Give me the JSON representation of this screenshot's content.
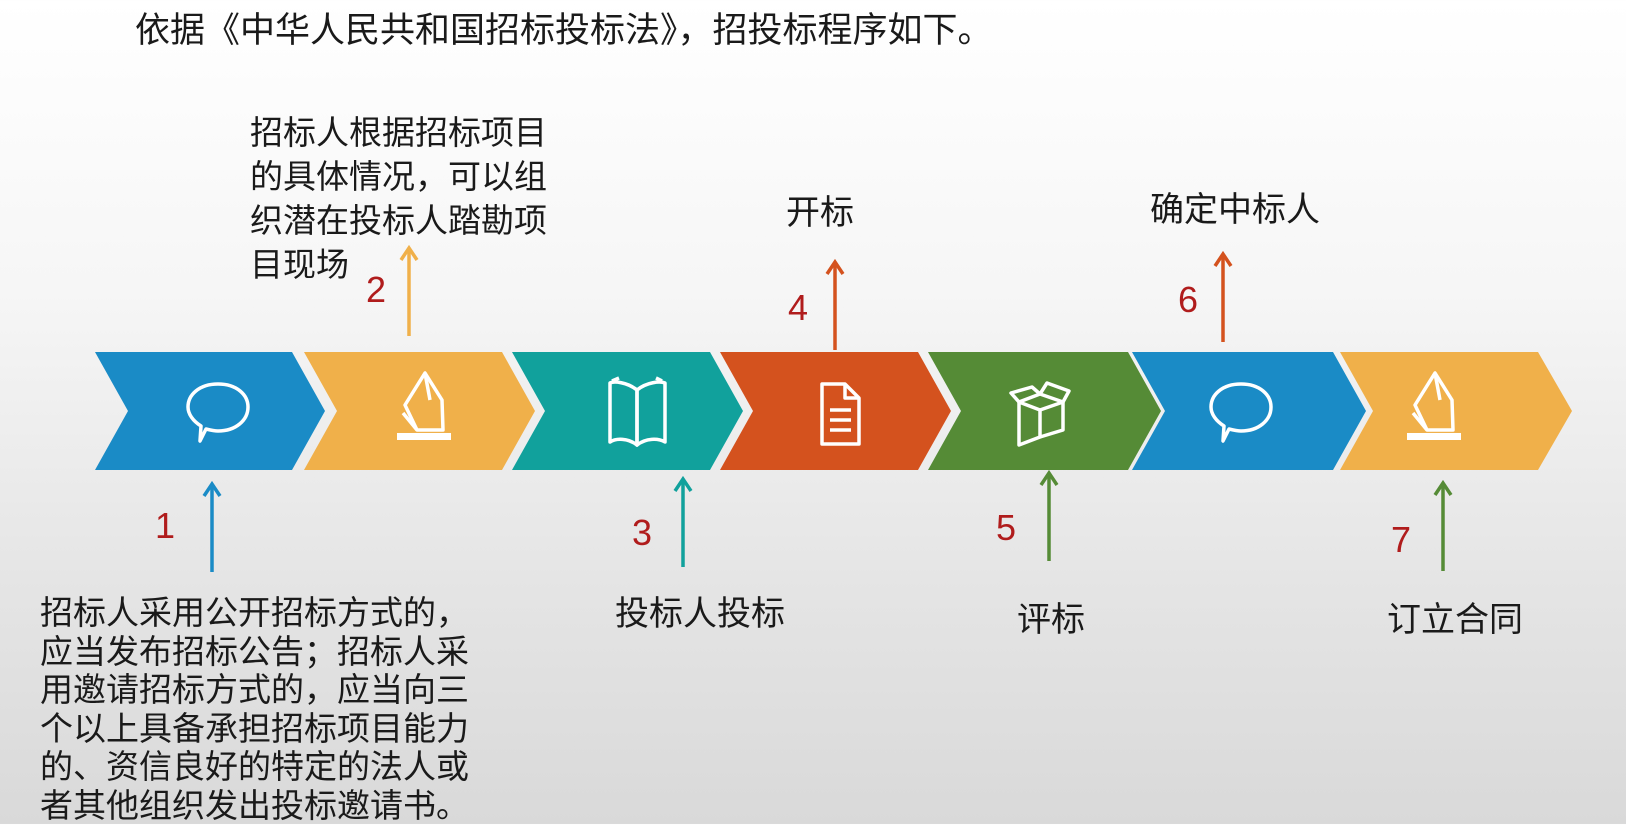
{
  "intro": "依据《中华人民共和国招标投标法》，招投标程序如下。",
  "colors": {
    "blue": "#1a8bc6",
    "yellow": "#f0b04a",
    "teal": "#11a19c",
    "orange": "#d4521e",
    "green": "#558b36",
    "number": "#b01c1c"
  },
  "chevrons": [
    {
      "color": "#1a8bc6",
      "icon": "speech-bubble-icon"
    },
    {
      "color": "#f0b04a",
      "icon": "ballot-box-icon"
    },
    {
      "color": "#11a19c",
      "icon": "open-book-icon"
    },
    {
      "color": "#d4521e",
      "icon": "document-icon"
    },
    {
      "color": "#558b36",
      "icon": "open-box-icon"
    },
    {
      "color": "#1a8bc6",
      "icon": "speech-bubble-icon"
    },
    {
      "color": "#f0b04a",
      "icon": "ballot-box-icon"
    }
  ],
  "steps": [
    {
      "number": "1",
      "text": "招标人采用公开招标方式的，\n应当发布招标公告；招标人采\n用邀请招标方式的，应当向三\n个以上具备承担招标项目能力\n的、资信良好的特定的法人或\n者其他组织发出投标邀请书。"
    },
    {
      "number": "2",
      "text": "招标人根据招标项目\n的具体情况，可以组\n织潜在投标人踏勘项\n目现场"
    },
    {
      "number": "3",
      "text": "投标人投标"
    },
    {
      "number": "4",
      "text": "开标"
    },
    {
      "number": "5",
      "text": "评标"
    },
    {
      "number": "6",
      "text": "确定中标人"
    },
    {
      "number": "7",
      "text": "订立合同"
    }
  ]
}
